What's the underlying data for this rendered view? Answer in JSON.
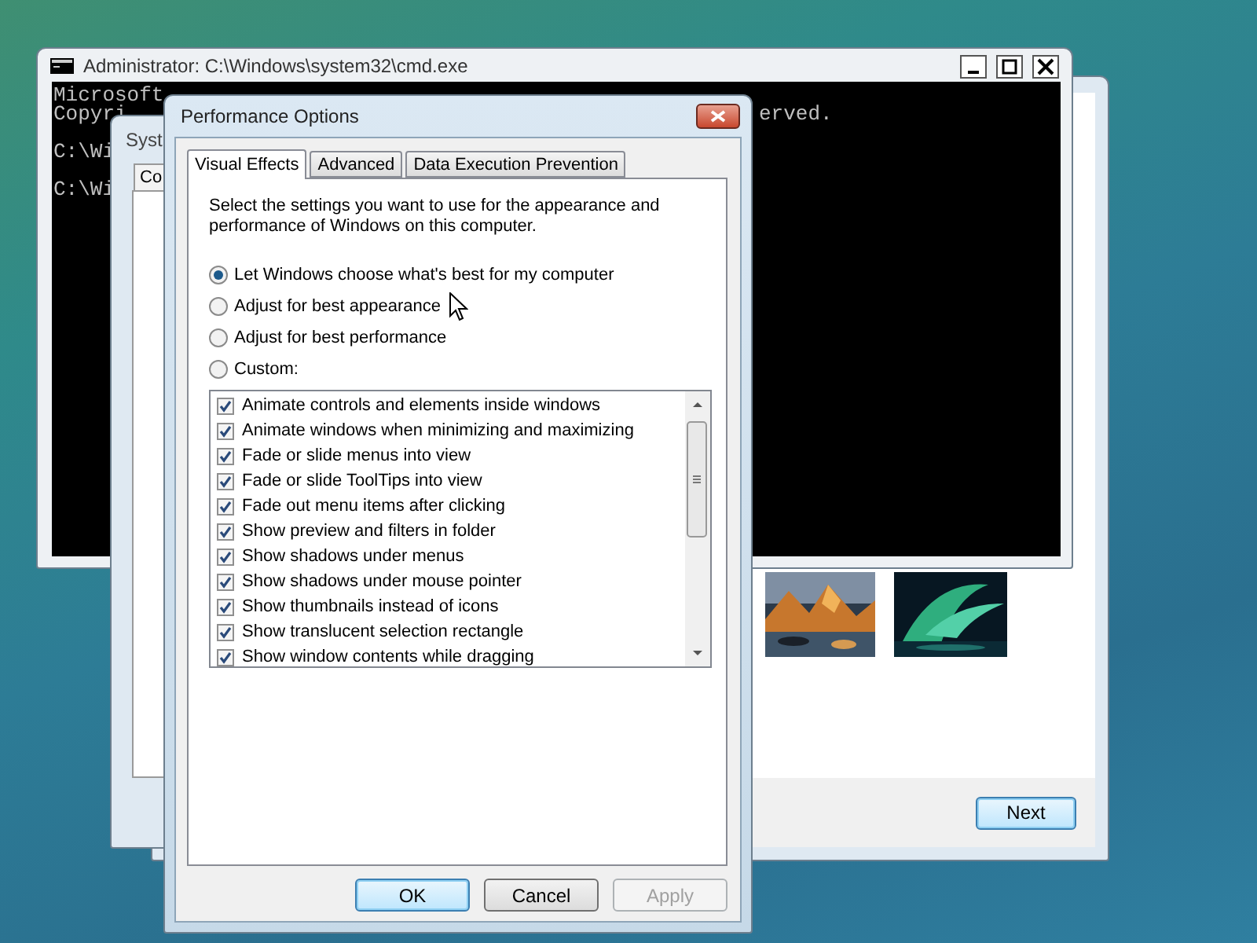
{
  "wizard_window": {
    "button": "Next"
  },
  "system_window": {
    "title": "Syst",
    "tab": "Co"
  },
  "console_window": {
    "title": "Administrator: C:\\Windows\\system32\\cmd.exe",
    "lines": [
      {
        "left": "Microsoft",
        "space_after": false
      },
      {
        "left": "Copyri",
        "right": "erved.",
        "space_after": true
      },
      {
        "left": "C:\\Wi",
        "space_after": true
      },
      {
        "left": "C:\\Wi",
        "space_after": false
      }
    ]
  },
  "dialog": {
    "title": "Performance Options",
    "tabs": [
      {
        "label": "Visual Effects",
        "selected": true
      },
      {
        "label": "Advanced",
        "selected": false
      },
      {
        "label": "Data Execution Prevention",
        "selected": false
      }
    ],
    "description": "Select the settings you want to use for the appearance and performance of Windows on this computer.",
    "options": [
      {
        "label": "Let Windows choose what's best for my computer",
        "selected": true
      },
      {
        "label": "Adjust for best appearance",
        "selected": false
      },
      {
        "label": "Adjust for best performance",
        "selected": false
      },
      {
        "label": "Custom:",
        "selected": false
      }
    ],
    "effects": [
      {
        "label": "Animate controls and elements inside windows",
        "checked": true
      },
      {
        "label": "Animate windows when minimizing and maximizing",
        "checked": true
      },
      {
        "label": "Fade or slide menus into view",
        "checked": true
      },
      {
        "label": "Fade or slide ToolTips into view",
        "checked": true
      },
      {
        "label": "Fade out menu items after clicking",
        "checked": true
      },
      {
        "label": "Show preview and filters in folder",
        "checked": true
      },
      {
        "label": "Show shadows under menus",
        "checked": true
      },
      {
        "label": "Show shadows under mouse pointer",
        "checked": true
      },
      {
        "label": "Show thumbnails instead of icons",
        "checked": true
      },
      {
        "label": "Show translucent selection rectangle",
        "checked": true
      },
      {
        "label": "Show window contents while dragging",
        "checked": true
      }
    ],
    "buttons": [
      {
        "label": "OK",
        "default": true,
        "disabled": false
      },
      {
        "label": "Cancel",
        "default": false,
        "disabled": false
      },
      {
        "label": "Apply",
        "default": false,
        "disabled": true
      }
    ]
  }
}
